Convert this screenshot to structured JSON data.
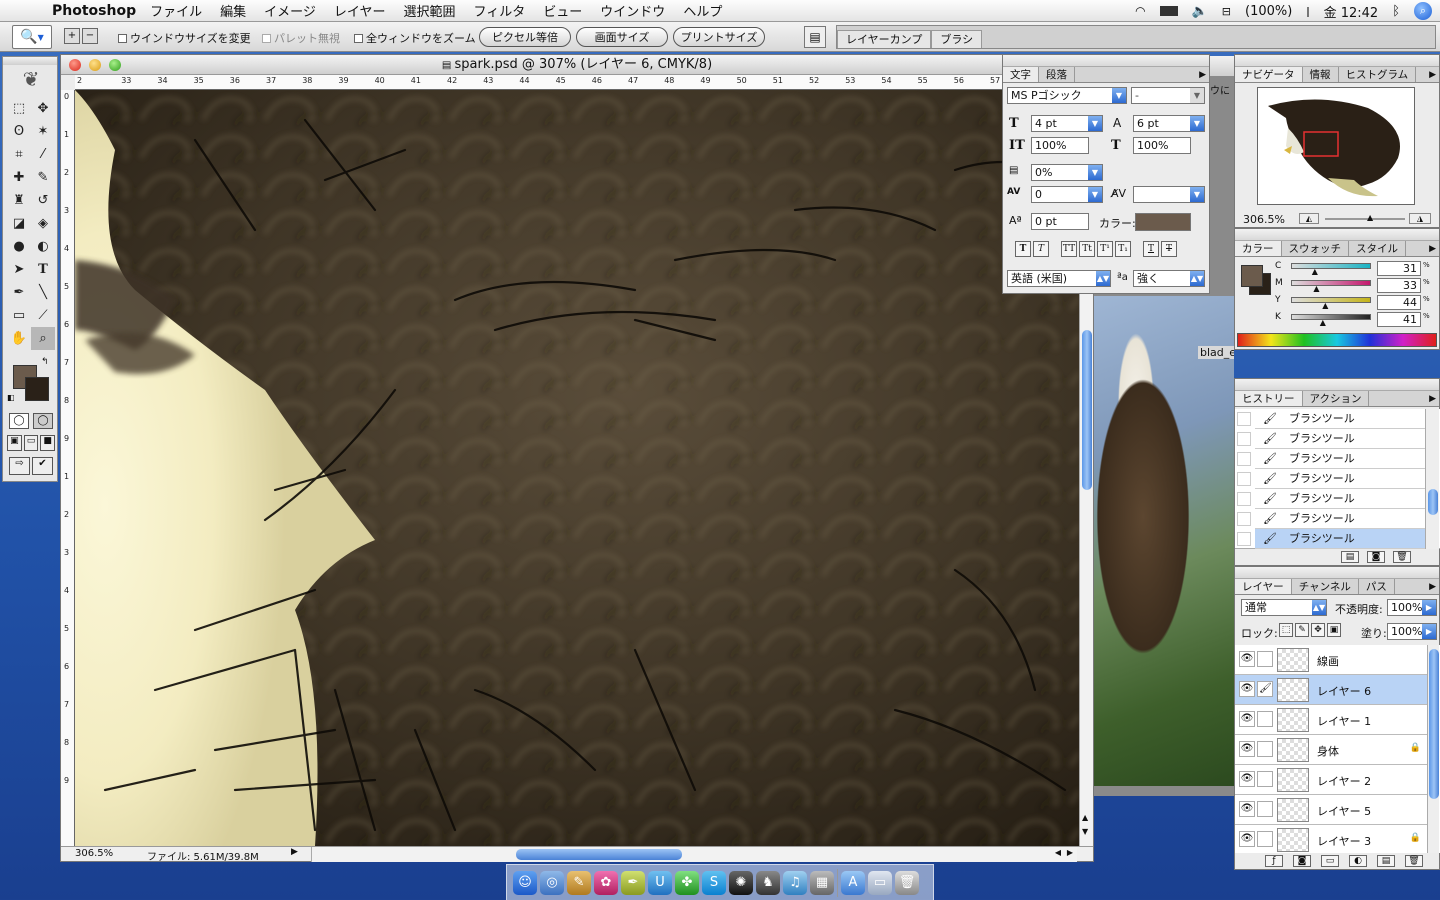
{
  "menubar": {
    "app_name": "Photoshop",
    "items": [
      "ファイル",
      "編集",
      "イメージ",
      "レイヤー",
      "選択範囲",
      "フィルタ",
      "ビュー",
      "ウインドウ",
      "ヘルプ"
    ],
    "battery": "(100%)",
    "clock": "金 12:42"
  },
  "options_bar": {
    "resize_windows": "ウインドウサイズを変更",
    "ignore_palettes": "パレット無視",
    "zoom_all_windows": "全ウィンドウをズーム",
    "actual_pixels": "ピクセル等倍",
    "fit_screen": "画面サイズ",
    "print_size": "プリントサイズ",
    "well_tabs": [
      "レイヤーカンプ",
      "ブラシ"
    ]
  },
  "document": {
    "title": "spark.psd @ 307% (レイヤー 6, CMYK/8)",
    "zoom": "306.5%",
    "file_info": "ファイル: 5.61M/39.8M",
    "hruler_ticks": [
      "2",
      "33",
      "34",
      "35",
      "36",
      "37",
      "38",
      "39",
      "40",
      "41",
      "42",
      "43",
      "44",
      "45",
      "46",
      "47",
      "48",
      "49",
      "50",
      "51",
      "52",
      "53",
      "54",
      "55",
      "56",
      "57"
    ],
    "vruler_ticks": [
      "0",
      "1",
      "2",
      "3",
      "4",
      "5",
      "6",
      "7",
      "8",
      "9",
      "1",
      "2",
      "3",
      "4",
      "5",
      "6",
      "7",
      "8",
      "9"
    ]
  },
  "character_panel": {
    "tabs": [
      "文字",
      "段落"
    ],
    "font_family": "MS Pゴシック",
    "font_style": "-",
    "font_size": "4 pt",
    "leading": "6 pt",
    "vertical_scale": "100%",
    "horizontal_scale": "100%",
    "tsume": "0%",
    "kerning": "0",
    "tracking": "",
    "baseline_shift": "0 pt",
    "color_label": "カラー:",
    "color": "#6b5b4c",
    "style_buttons": [
      "T",
      "T",
      "TT",
      "Tt",
      "T¹",
      "T₁",
      "T",
      "T"
    ],
    "language": "英語 (米国)",
    "antialias": "強く",
    "antialias_icon": "ªa"
  },
  "navigator_panel": {
    "tabs": [
      "ナビゲータ",
      "情報",
      "ヒストグラム"
    ],
    "zoom": "306.5%"
  },
  "color_panel": {
    "tabs": [
      "カラー",
      "スウォッチ",
      "スタイル"
    ],
    "channels": [
      {
        "label": "C",
        "value": "31",
        "unit": "%"
      },
      {
        "label": "M",
        "value": "33",
        "unit": "%"
      },
      {
        "label": "Y",
        "value": "44",
        "unit": "%"
      },
      {
        "label": "K",
        "value": "41",
        "unit": "%"
      }
    ],
    "foreground": "#6b5b4c",
    "background": "#2a2118"
  },
  "history_panel": {
    "tabs": [
      "ヒストリー",
      "アクション"
    ],
    "items": [
      "ブラシツール",
      "ブラシツール",
      "ブラシツール",
      "ブラシツール",
      "ブラシツール",
      "ブラシツール",
      "ブラシツール"
    ]
  },
  "layers_panel": {
    "tabs": [
      "レイヤー",
      "チャンネル",
      "パス"
    ],
    "blend_mode": "通常",
    "opacity_label": "不透明度:",
    "opacity": "100%",
    "lock_label": "ロック:",
    "fill_label": "塗り:",
    "fill": "100%",
    "layers": [
      {
        "name": "線画",
        "locked": false,
        "selected": false
      },
      {
        "name": "レイヤー 6",
        "locked": false,
        "selected": true
      },
      {
        "name": "レイヤー 1",
        "locked": false,
        "selected": false
      },
      {
        "name": "身体",
        "locked": true,
        "selected": false
      },
      {
        "name": "レイヤー 2",
        "locked": false,
        "selected": false
      },
      {
        "name": "レイヤー 5",
        "locked": false,
        "selected": false
      },
      {
        "name": "レイヤー 3",
        "locked": true,
        "selected": false
      }
    ]
  },
  "desktop": {
    "fragment_top": "ウに",
    "fragment_label": "blad_e"
  },
  "icons": {
    "apple": "",
    "zoom_tool": "🔍",
    "eye": "👁",
    "lock": "🔒",
    "brush": "🖌"
  }
}
